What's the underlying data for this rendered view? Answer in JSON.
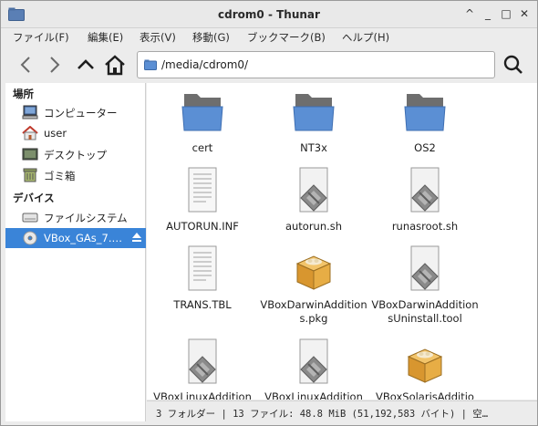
{
  "window": {
    "title": "cdrom0 - Thunar"
  },
  "window_buttons": {
    "maximize_glyph": "^",
    "minimize_glyph": "_",
    "restore_glyph": "□",
    "close_glyph": "✕"
  },
  "menu": [
    "ファイル(F)",
    "編集(E)",
    "表示(V)",
    "移動(G)",
    "ブックマーク(B)",
    "ヘルプ(H)"
  ],
  "location": {
    "path": "/media/cdrom0/"
  },
  "sidebar": {
    "places_header": "場所",
    "places": [
      "コンピューター",
      "user",
      "デスクトップ",
      "ゴミ箱"
    ],
    "devices_header": "デバイス",
    "devices": [
      "ファイルシステム",
      "VBox_GAs_7.…"
    ]
  },
  "files": [
    {
      "name": "cert",
      "icon": "folder-icon"
    },
    {
      "name": "NT3x",
      "icon": "folder-icon"
    },
    {
      "name": "OS2",
      "icon": "folder-icon"
    },
    {
      "name": "AUTORUN.INF",
      "icon": "text-file-icon"
    },
    {
      "name": "autorun.sh",
      "icon": "script-file-icon"
    },
    {
      "name": "runasroot.sh",
      "icon": "script-file-icon"
    },
    {
      "name": "TRANS.TBL",
      "icon": "text-file-icon"
    },
    {
      "name": "VBoxDarwinAdditions.pkg",
      "icon": "package-icon"
    },
    {
      "name": "VBoxDarwinAdditionsUninstall.tool",
      "icon": "script-file-icon"
    },
    {
      "name": "VBoxLinuxAddition",
      "icon": "script-file-icon"
    },
    {
      "name": "VBoxLinuxAddition",
      "icon": "script-file-icon"
    },
    {
      "name": "VBoxSolarisAdditio",
      "icon": "package-icon"
    }
  ],
  "status": "3 フォルダー | 13 ファイル: 48.8 MiB (51,192,583 バイト) | 空…",
  "colors": {
    "accent": "#3a84d8",
    "folder_blue": "#5b8fd4",
    "folder_dark": "#6e6e6e"
  }
}
